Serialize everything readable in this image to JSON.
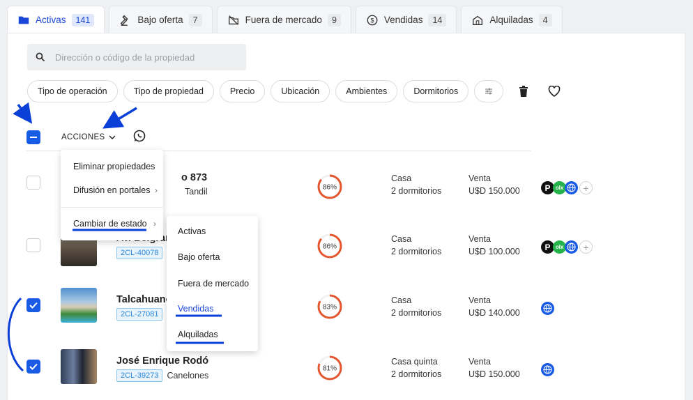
{
  "tabs": [
    {
      "label": "Activas",
      "count": "141",
      "icon": "folder-icon"
    },
    {
      "label": "Bajo oferta",
      "count": "7",
      "icon": "gavel-icon"
    },
    {
      "label": "Fuera de mercado",
      "count": "9",
      "icon": "off-market-icon"
    },
    {
      "label": "Vendidas",
      "count": "14",
      "icon": "dollar-circle-icon"
    },
    {
      "label": "Alquiladas",
      "count": "4",
      "icon": "house-key-icon"
    }
  ],
  "search": {
    "placeholder": "Dirección o código de la propiedad"
  },
  "filters": [
    "Tipo de operación",
    "Tipo de propiedad",
    "Precio",
    "Ubicación",
    "Ambientes",
    "Dormitorios"
  ],
  "toolbar": {
    "actions_label": "ACCIONES"
  },
  "actions_menu": {
    "items": [
      "Eliminar propiedades",
      "Difusión en portales",
      "Cambiar de estado"
    ]
  },
  "status_submenu": {
    "items": [
      "Activas",
      "Bajo oferta",
      "Fuera de mercado",
      "Vendidas",
      "Alquiladas"
    ]
  },
  "properties": [
    {
      "title": "o 873",
      "code": "",
      "city": "Tandil",
      "score": "86%",
      "type": "Casa",
      "bedrooms": "2 dormitorios",
      "operation": "Venta",
      "price": "U$D 150.000",
      "checked": false
    },
    {
      "title": "Av. Belgran",
      "code": "2CL-40078",
      "city": "",
      "score": "86%",
      "type": "Casa",
      "bedrooms": "2 dormitorios",
      "operation": "Venta",
      "price": "U$D 100.000",
      "checked": false
    },
    {
      "title": "Talcahuano",
      "code": "2CL-27081",
      "city": "",
      "score": "83%",
      "type": "Casa",
      "bedrooms": "2 dormitorios",
      "operation": "Venta",
      "price": "U$D 140.000",
      "checked": true
    },
    {
      "title": "José Enrique Rodó",
      "code": "2CL-39273",
      "city": "Canelones",
      "score": "81%",
      "type": "Casa quinta",
      "bedrooms": "2 dormitorios",
      "operation": "Venta",
      "price": "U$D 150.000",
      "checked": true
    }
  ],
  "portal_badges": {
    "p": "P",
    "olx": "olx"
  },
  "colors": {
    "accent": "#1a5be6",
    "score_ring": "#e4572e",
    "annotation": "#0a3fd8"
  }
}
